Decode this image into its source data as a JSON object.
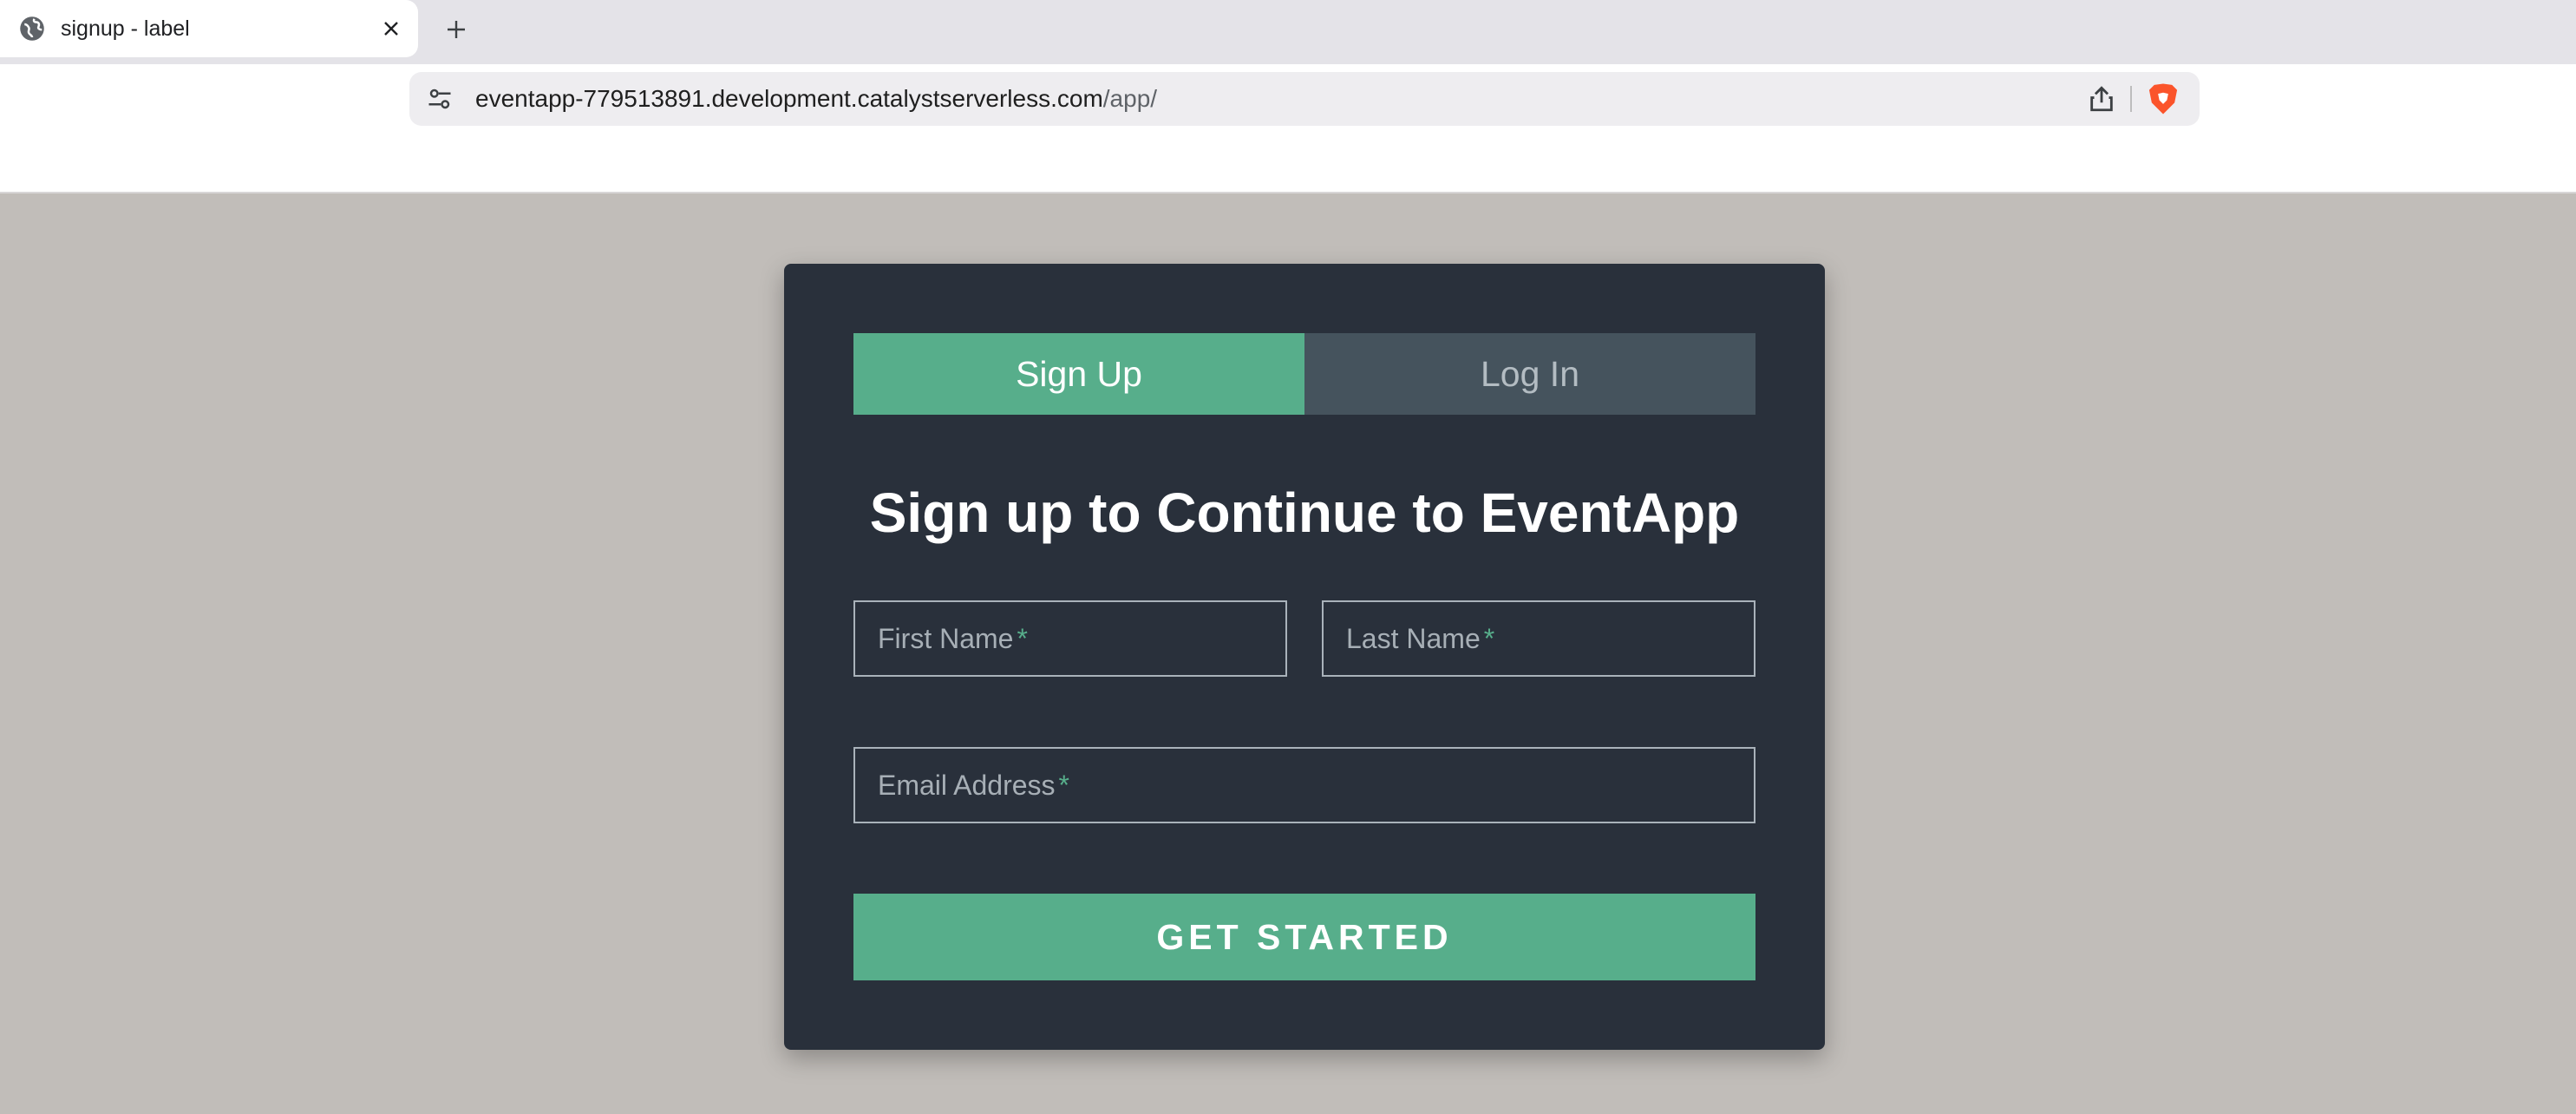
{
  "browser": {
    "tab_title": "signup - label",
    "url_host": "eventapp-779513891.development.catalystserverless.com",
    "url_path": "/app/",
    "icons": {
      "tab": "globe-icon",
      "close": "close-icon",
      "new_tab": "plus-icon",
      "site_settings": "tune-icon",
      "share": "share-icon",
      "brave": "brave-lion-icon"
    }
  },
  "signup_card": {
    "tabs": [
      {
        "label": "Sign Up",
        "active": true
      },
      {
        "label": "Log In",
        "active": false
      }
    ],
    "heading": "Sign up to Continue to EventApp",
    "fields": {
      "first_name": {
        "placeholder": "First Name",
        "required_mark": "*"
      },
      "last_name": {
        "placeholder": "Last Name",
        "required_mark": "*"
      },
      "email": {
        "placeholder": "Email Address",
        "required_mark": "*"
      }
    },
    "submit_label": "GET STARTED"
  },
  "colors": {
    "page_background": "#c1bdb9",
    "card_background": "#29303b",
    "accent_green": "#57ae8b",
    "inactive_tab": "#45535d"
  }
}
